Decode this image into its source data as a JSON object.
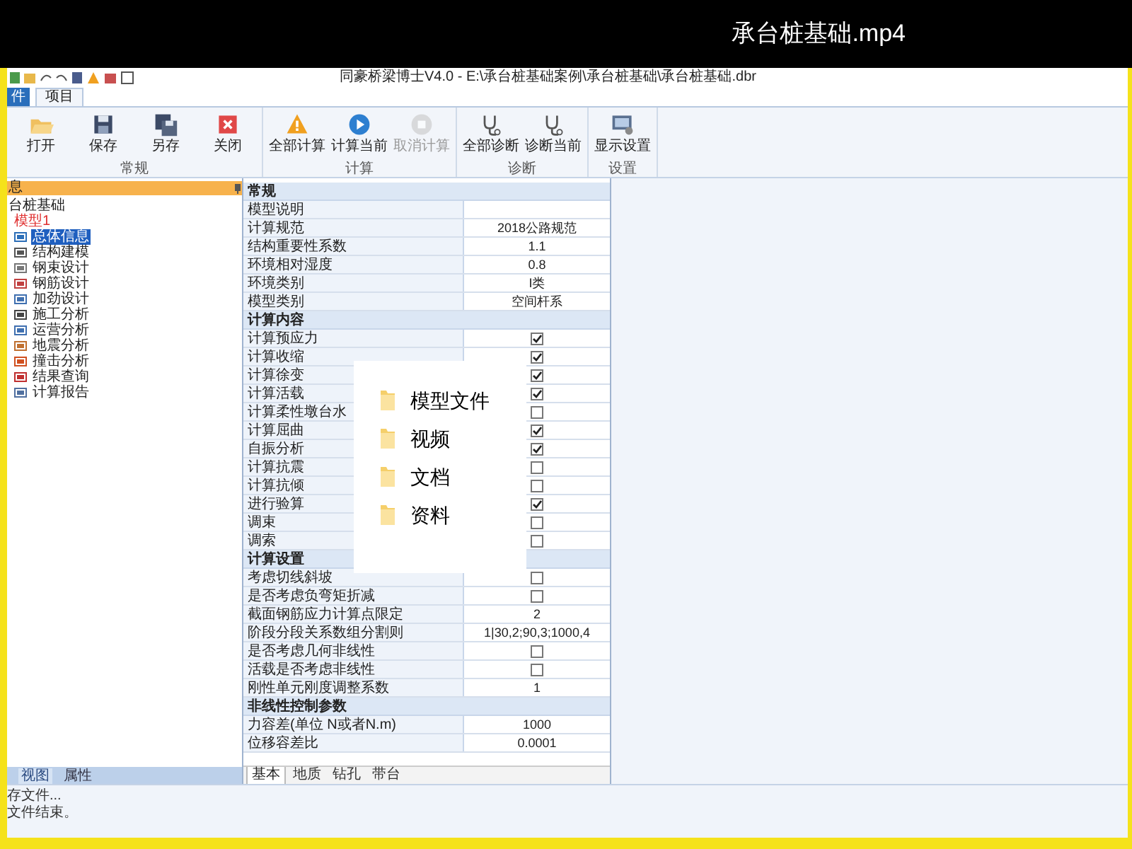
{
  "video_title": "承台桩基础.mp4",
  "window": {
    "title": "同豪桥梁博士V4.0 - E:\\承台桩基础案例\\承台桩基础\\承台桩基础.dbr"
  },
  "ribbon_tabs": [
    {
      "label": "件",
      "kind": "file",
      "selected": false
    },
    {
      "label": "项目",
      "kind": "tab",
      "selected": true
    }
  ],
  "ribbon_groups": [
    {
      "label": "常规",
      "buttons": [
        {
          "label": "打开",
          "kind": "open",
          "disabled": false
        },
        {
          "label": "保存",
          "kind": "save",
          "disabled": false
        },
        {
          "label": "另存",
          "kind": "saveas",
          "disabled": false
        },
        {
          "label": "关闭",
          "kind": "close",
          "disabled": false
        }
      ]
    },
    {
      "label": "计算",
      "buttons": [
        {
          "label": "全部计算",
          "kind": "warning",
          "disabled": false
        },
        {
          "label": "计算当前",
          "kind": "play",
          "disabled": false
        },
        {
          "label": "取消计算",
          "kind": "stop",
          "disabled": true
        }
      ]
    },
    {
      "label": "诊断",
      "buttons": [
        {
          "label": "全部诊断",
          "kind": "stetho",
          "disabled": false
        },
        {
          "label": "诊断当前",
          "kind": "stetho",
          "disabled": false
        }
      ]
    },
    {
      "label": "设置",
      "buttons": [
        {
          "label": "显示设置",
          "kind": "display",
          "disabled": false
        }
      ]
    }
  ],
  "sidebar": {
    "title": "息",
    "tree": [
      {
        "label": "台桩基础",
        "children": [
          {
            "label": "模型1",
            "children": [
              {
                "label": "总体信息",
                "selected": true
              },
              {
                "label": "结构建模",
                "selected": false
              },
              {
                "label": "钢束设计",
                "selected": false
              },
              {
                "label": "钢筋设计",
                "selected": false
              },
              {
                "label": "加劲设计",
                "selected": false
              },
              {
                "label": "施工分析",
                "selected": false
              },
              {
                "label": "运营分析",
                "selected": false
              },
              {
                "label": "地震分析",
                "selected": false
              },
              {
                "label": "撞击分析",
                "selected": false
              },
              {
                "label": "结果查询",
                "selected": false
              },
              {
                "label": "计算报告",
                "selected": false
              }
            ]
          }
        ]
      }
    ],
    "tabs": [
      {
        "label": "视图",
        "selected": true
      },
      {
        "label": "属性",
        "selected": false
      }
    ]
  },
  "properties": {
    "sections": [
      {
        "title": "常规",
        "rows": [
          {
            "label": "模型说明",
            "kind": "text"
          },
          {
            "label": "计算规范",
            "kind": "text",
            "value": "2018公路规范"
          },
          {
            "label": "结构重要性系数",
            "kind": "text",
            "value": "1.1"
          },
          {
            "label": "环境相对湿度",
            "kind": "text",
            "value": "0.8"
          },
          {
            "label": "环境类别",
            "kind": "text",
            "value": "I类"
          },
          {
            "label": "模型类别",
            "kind": "text",
            "value": "空间杆系"
          }
        ]
      },
      {
        "title": "计算内容",
        "rows": [
          {
            "label": "计算预应力",
            "kind": "check",
            "checked": true
          },
          {
            "label": "计算收缩",
            "kind": "check",
            "checked": true
          },
          {
            "label": "计算徐变",
            "kind": "check",
            "checked": true
          },
          {
            "label": "计算活载",
            "kind": "check",
            "checked": true
          },
          {
            "label": "计算柔性墩台水",
            "kind": "check",
            "checked": false
          },
          {
            "label": "计算屈曲",
            "kind": "check",
            "checked": true
          },
          {
            "label": "自振分析",
            "kind": "check",
            "checked": true
          },
          {
            "label": "计算抗震",
            "kind": "check",
            "checked": false
          },
          {
            "label": "计算抗倾",
            "kind": "check",
            "checked": false
          },
          {
            "label": "进行验算",
            "kind": "check",
            "checked": true
          },
          {
            "label": "调束",
            "kind": "check",
            "checked": false
          },
          {
            "label": "调索",
            "kind": "check",
            "checked": false
          }
        ]
      },
      {
        "title": "计算设置",
        "rows": [
          {
            "label": "考虑切线斜坡",
            "kind": "check",
            "checked": false
          },
          {
            "label": "是否考虑负弯矩折减",
            "kind": "check",
            "checked": false
          },
          {
            "label": "截面钢筋应力计算点限定",
            "kind": "text",
            "value": "2"
          },
          {
            "label": "阶段分段关系数组分割则",
            "kind": "text",
            "value": "1|30,2;90,3;1000,4"
          },
          {
            "label": "是否考虑几何非线性",
            "kind": "check",
            "checked": false
          },
          {
            "label": "活载是否考虑非线性",
            "kind": "check",
            "checked": false
          },
          {
            "label": "刚性单元刚度调整系数",
            "kind": "text",
            "value": "1"
          }
        ]
      },
      {
        "title": "非线性控制参数",
        "rows": [
          {
            "label": "力容差(单位 N或者N.m)",
            "kind": "text",
            "value": "1000"
          },
          {
            "label": "位移容差比",
            "kind": "text",
            "value": "0.0001"
          }
        ]
      }
    ],
    "tabs": [
      {
        "label": "基本",
        "selected": true
      },
      {
        "label": "地质",
        "selected": false
      },
      {
        "label": "钻孔",
        "selected": false
      },
      {
        "label": "带台",
        "selected": false
      }
    ]
  },
  "popup": {
    "items": [
      {
        "label": "模型文件"
      },
      {
        "label": "视频"
      },
      {
        "label": "文档"
      },
      {
        "label": "资料"
      }
    ]
  },
  "status_lines": [
    "存文件...",
    "文件结束。"
  ]
}
